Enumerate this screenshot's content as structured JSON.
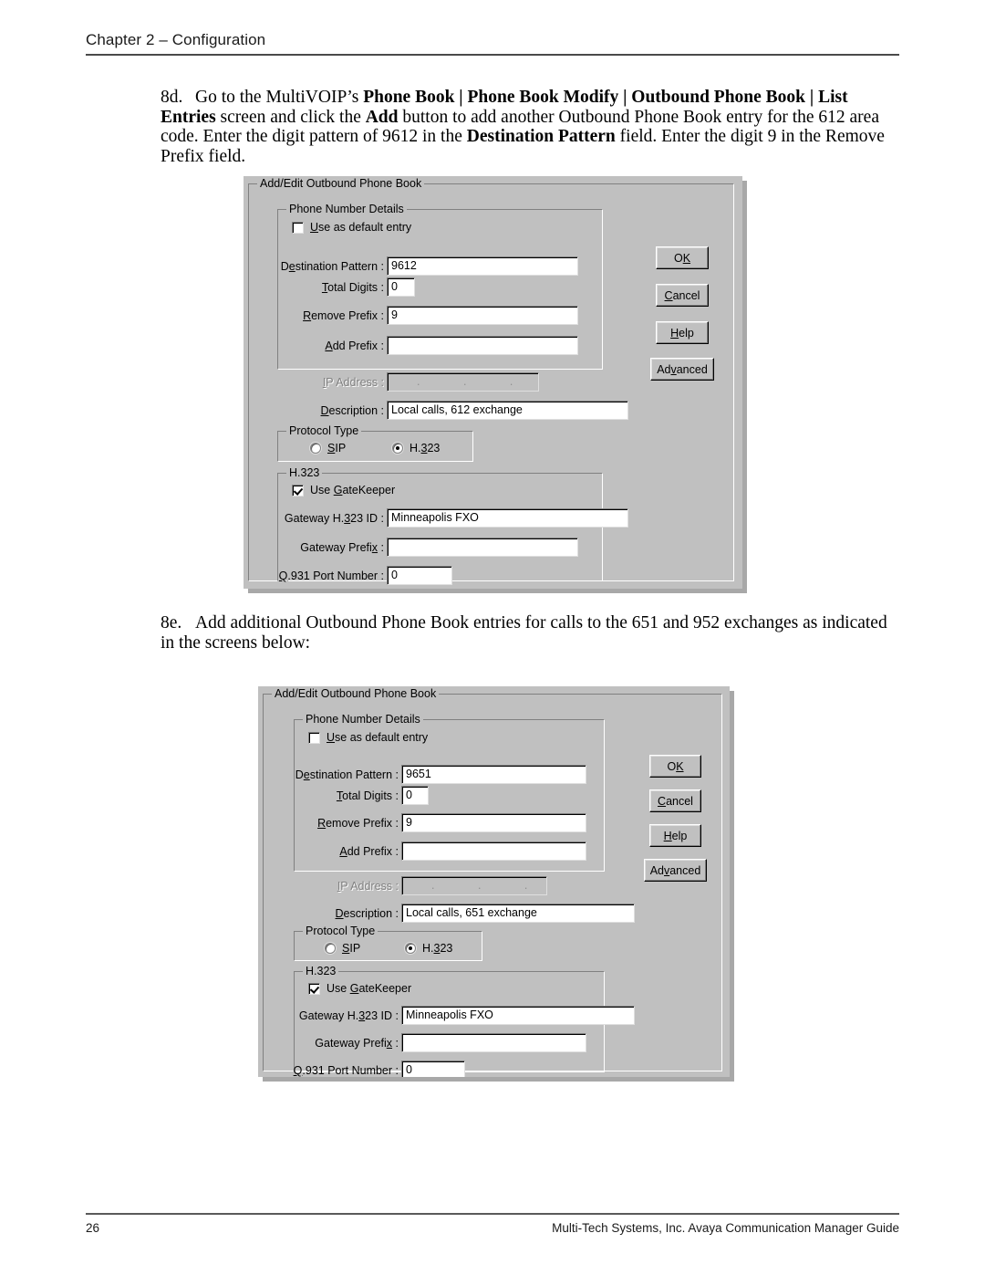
{
  "page": {
    "header_title": "Chapter 2 – Configuration",
    "footer_page_number": "26",
    "footer_guide": "Multi-Tech Systems, Inc. Avaya Communication Manager Guide"
  },
  "steps": [
    {
      "number": "8d.",
      "text_runs": [
        {
          "t": "Go to the MultiVOIP’s ",
          "bold": false
        },
        {
          "t": "Phone Book | Phone Book Modify | Outbound Phone Book | List Entries",
          "bold": true
        },
        {
          "t": " screen and click the ",
          "bold": false
        },
        {
          "t": "Add",
          "bold": true
        },
        {
          "t": " button to add another Outbound Phone Book entry for the 612 area code.  Enter the digit pattern of 9612 in the ",
          "bold": false
        },
        {
          "t": "Destination Pattern",
          "bold": true
        },
        {
          "t": " field.  Enter the digit 9 in the Remove Prefix field.",
          "bold": false
        }
      ]
    },
    {
      "number": "8e.",
      "text_runs": [
        {
          "t": "Add additional Outbound Phone Book entries for calls to the 651 and 952 exchanges as indicated in the screens below:",
          "bold": false
        }
      ]
    }
  ],
  "dialogs": [
    {
      "title": "Add/Edit Outbound Phone Book",
      "phone_number_details": {
        "caption": "Phone Number Details",
        "use_as_default_entry": {
          "label": "Use as default entry",
          "accel": "U",
          "checked": false
        },
        "destination_pattern": {
          "label": "Destination Pattern :",
          "accel": "e",
          "value": "9612"
        },
        "total_digits": {
          "label": "Total Digits :",
          "accel": "T",
          "value": "0"
        },
        "remove_prefix": {
          "label": "Remove Prefix :",
          "accel": "R",
          "value": "9"
        },
        "add_prefix": {
          "label": "Add Prefix :",
          "accel": "A",
          "value": ""
        }
      },
      "ip_address": {
        "label": "IP Address :",
        "accel": "I",
        "value": ".    .    .",
        "disabled": true
      },
      "description": {
        "label": "Description :",
        "accel": "D",
        "value": "Local calls, 612 exchange"
      },
      "protocol_type": {
        "caption": "Protocol Type",
        "options": [
          {
            "label": "SIP",
            "accel": "S",
            "selected": false
          },
          {
            "label": "H.323",
            "accel": "3",
            "selected": true
          }
        ]
      },
      "h323": {
        "caption": "H.323",
        "use_gatekeeper": {
          "label": "Use GateKeeper",
          "accel": "G",
          "checked": true
        },
        "gateway_h323_id": {
          "label": "Gateway H.323 ID :",
          "accel": "3",
          "value": "Minneapolis FXO"
        },
        "gateway_prefix": {
          "label": "Gateway Prefix :",
          "accel": "x",
          "value": ""
        },
        "q931_port_number": {
          "label": "Q.931 Port Number :",
          "accel": "Q",
          "value": "0"
        }
      },
      "buttons": [
        {
          "label": "OK",
          "accel": "K"
        },
        {
          "label": "Cancel",
          "accel": "C"
        },
        {
          "label": "Help",
          "accel": "H"
        },
        {
          "label": "Advanced",
          "accel": "v"
        }
      ]
    },
    {
      "title": "Add/Edit Outbound Phone Book",
      "phone_number_details": {
        "caption": "Phone Number Details",
        "use_as_default_entry": {
          "label": "Use as default entry",
          "accel": "U",
          "checked": false
        },
        "destination_pattern": {
          "label": "Destination Pattern :",
          "accel": "e",
          "value": "9651"
        },
        "total_digits": {
          "label": "Total Digits :",
          "accel": "T",
          "value": "0"
        },
        "remove_prefix": {
          "label": "Remove Prefix :",
          "accel": "R",
          "value": "9"
        },
        "add_prefix": {
          "label": "Add Prefix :",
          "accel": "A",
          "value": ""
        }
      },
      "ip_address": {
        "label": "IP Address :",
        "accel": "I",
        "value": ".    .    .",
        "disabled": true
      },
      "description": {
        "label": "Description :",
        "accel": "D",
        "value": "Local calls, 651 exchange"
      },
      "protocol_type": {
        "caption": "Protocol Type",
        "options": [
          {
            "label": "SIP",
            "accel": "S",
            "selected": false
          },
          {
            "label": "H.323",
            "accel": "3",
            "selected": true
          }
        ]
      },
      "h323": {
        "caption": "H.323",
        "use_gatekeeper": {
          "label": "Use GateKeeper",
          "accel": "G",
          "checked": true
        },
        "gateway_h323_id": {
          "label": "Gateway H.323 ID :",
          "accel": "3",
          "value": "Minneapolis FXO"
        },
        "gateway_prefix": {
          "label": "Gateway Prefix :",
          "accel": "x",
          "value": ""
        },
        "q931_port_number": {
          "label": "Q.931 Port Number :",
          "accel": "Q",
          "value": "0"
        }
      },
      "buttons": [
        {
          "label": "OK",
          "accel": "K"
        },
        {
          "label": "Cancel",
          "accel": "C"
        },
        {
          "label": "Help",
          "accel": "H"
        },
        {
          "label": "Advanced",
          "accel": "v"
        }
      ]
    }
  ]
}
